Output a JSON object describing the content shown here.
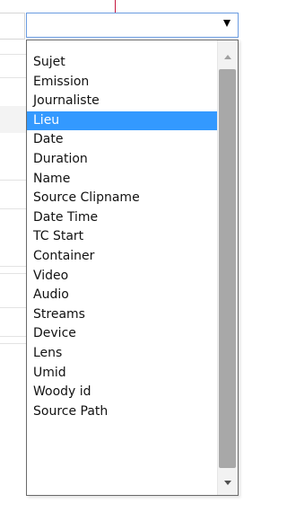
{
  "select": {
    "current_value": "",
    "selected_index": 3,
    "options": [
      "Sujet",
      "Emission",
      "Journaliste",
      "Lieu",
      "Date",
      "Duration",
      "Name",
      "Source Clipname",
      "Date Time",
      "TC Start",
      "Container",
      "Video",
      "Audio",
      "Streams",
      "Device",
      "Lens",
      "Umid",
      "Woody id",
      "Source Path"
    ]
  },
  "icons": {
    "dropdown_arrow": "triangle-down",
    "scroll_up": "triangle-up",
    "scroll_down": "triangle-down"
  },
  "colors": {
    "selected_background": "#3399ff",
    "selected_text": "#ffffff",
    "focus_border": "#6a9be0",
    "accent_line": "#c6183f"
  }
}
